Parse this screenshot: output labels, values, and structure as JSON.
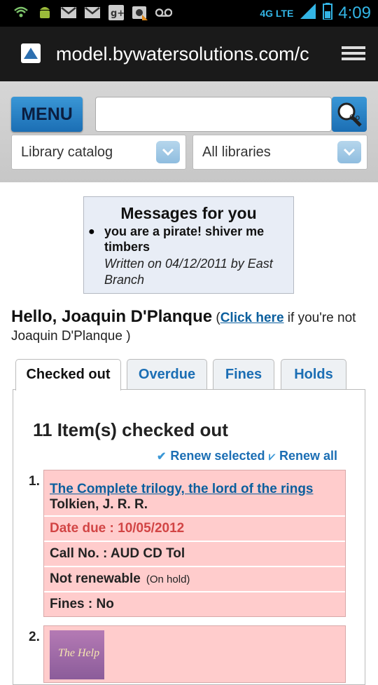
{
  "status_bar": {
    "time": "4:09",
    "network": "4G LTE",
    "icons": [
      "wifi-icon",
      "android-icon",
      "gmail-icon",
      "gmail-icon",
      "google-plus-icon",
      "camera-icon",
      "voicemail-icon"
    ]
  },
  "browser": {
    "url": "model.bywatersolutions.com/c"
  },
  "header": {
    "menu_label": "MENU",
    "search_placeholder": "",
    "catalog_select": "Library catalog",
    "library_select": "All libraries"
  },
  "messages": {
    "title": "Messages for you",
    "items": [
      {
        "text": "you are a pirate! shiver me timbers",
        "written": "Written on 04/12/2011 by East Branch"
      }
    ]
  },
  "greeting": {
    "hello": "Hello, Joaquin D'Planque",
    "link": "Click here",
    "suffix": " if you're not Joaquin D'Planque )"
  },
  "tabs": [
    "Checked out",
    "Overdue",
    "Fines",
    "Holds"
  ],
  "checked_out": {
    "title": "11 Item(s) checked out",
    "renew_selected": "Renew selected",
    "renew_all": "Renew all",
    "items": [
      {
        "number": "1.",
        "title": "The Complete trilogy, the lord of the rings",
        "author": "Tolkien, J. R. R.",
        "date_due": "Date due : 10/05/2012",
        "call_no": "Call No. : AUD CD Tol",
        "renewable": "Not renewable",
        "renew_note": "(On hold)",
        "fines": "Fines : No"
      },
      {
        "number": "2.",
        "cover_text": "The Help"
      }
    ]
  },
  "colors": {
    "accent": "#1b6eb4",
    "due": "#d24545",
    "card_bg": "#ffcccc"
  }
}
